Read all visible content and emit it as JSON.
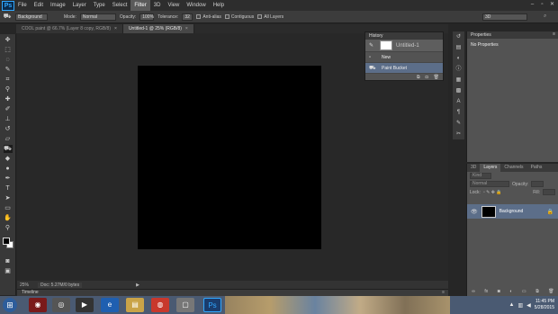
{
  "app": {
    "logo": "Ps",
    "name": "Adobe Photoshop"
  },
  "menu": [
    "File",
    "Edit",
    "Image",
    "Layer",
    "Type",
    "Select",
    "Filter",
    "3D",
    "View",
    "Window",
    "Help"
  ],
  "menu_active": "Filter",
  "options": {
    "mode_source": "Background",
    "mode_label": "Mode:",
    "mode_value": "Normal",
    "opacity_label": "Opacity:",
    "opacity_value": "100%",
    "tolerance_label": "Tolerance:",
    "tolerance_value": "32",
    "anti_alias": "Anti-alias",
    "contiguous": "Contiguous",
    "all_layers": "All Layers",
    "workspace": "3D"
  },
  "tabs": [
    {
      "label": "COOL paint @ 66.7% (Layer 8 copy, RGB/8)",
      "active": false
    },
    {
      "label": "Untitled-1 @ 25% (RGB/8)",
      "active": true
    }
  ],
  "status": {
    "zoom": "25%",
    "doc": "Doc: 5.27M/0 bytes"
  },
  "timeline": {
    "label": "Timeline"
  },
  "history": {
    "tab": "History",
    "snapshot": "Untitled-1",
    "items": [
      {
        "label": "New",
        "active": false
      },
      {
        "label": "Paint Bucket",
        "active": true
      }
    ]
  },
  "properties": {
    "tab": "Properties",
    "body": "No Properties"
  },
  "layers": {
    "tabs": [
      "3D",
      "Layers",
      "Channels",
      "Paths"
    ],
    "active_tab": "Layers",
    "kind": "Kind",
    "blend": "Normal",
    "opacity_label": "Opacity:",
    "lock_label": "Lock:",
    "fill_label": "Fill:",
    "layer_name": "Background"
  },
  "taskbar": {
    "time": "11:45 PM",
    "date": "5/28/2015"
  },
  "colors": {
    "accent": "#5c6e89",
    "taskbar": "#4a5a72",
    "ps_blue": "#31a8ff"
  }
}
